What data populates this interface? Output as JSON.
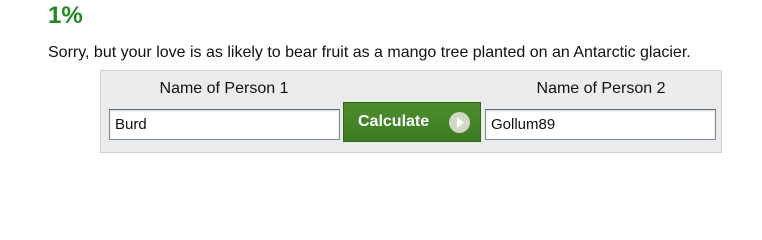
{
  "result": {
    "percent": "1%",
    "message": "Sorry, but your love is as likely to bear fruit as a mango tree planted on an Antarctic glacier."
  },
  "calculator": {
    "person1_label": "Name of Person 1",
    "person1_value": "Burd",
    "person2_label": "Name of Person 2",
    "person2_value": "Gollum89",
    "button_label": "Calculate",
    "button_icon": "arrow-right-circle-icon"
  },
  "colors": {
    "percent": "#1f8a1f",
    "button": "#45832a",
    "panel": "#ececec"
  }
}
